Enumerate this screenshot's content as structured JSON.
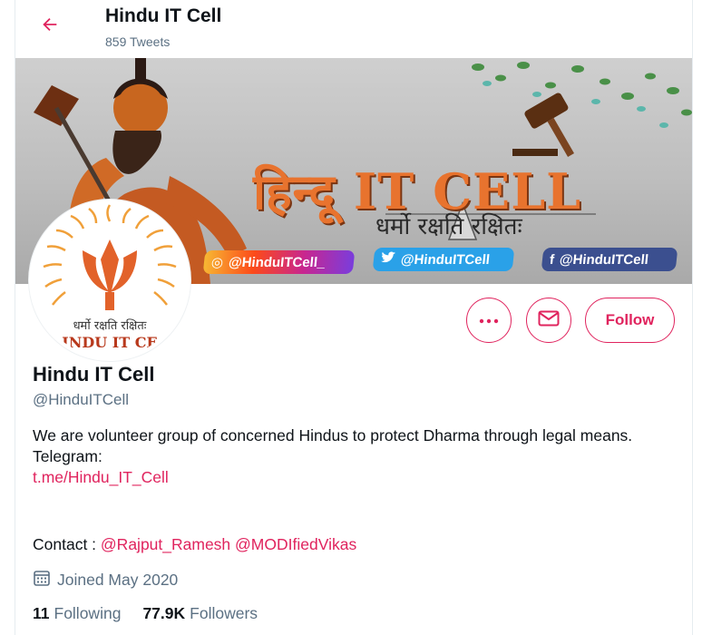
{
  "header": {
    "title": "Hindu IT Cell",
    "tweet_count": "859 Tweets"
  },
  "banner": {
    "title": "हिन्दू IT CELL",
    "motto": "धर्मो रक्षति रक्षितः",
    "instagram": "@HinduITCell_",
    "twitter": "@HinduITCell",
    "facebook": "@HinduITCell"
  },
  "avatar": {
    "motto": "धर्मो रक्षति रक्षितः",
    "name": "INDU IT CE"
  },
  "profile": {
    "name": "Hindu IT Cell",
    "handle": "@HinduITCell",
    "bio_line": "We are volunteer group of concerned Hindus to protect Dharma through legal means.",
    "telegram_label": "Telegram:",
    "telegram_link": "t.me/Hindu_IT_Cell",
    "contact_label": "Contact :",
    "contact_1": "@Rajput_Ramesh",
    "contact_2": "@MODIfiedVikas",
    "joined": "Joined May 2020",
    "following_count": "11",
    "following_label": "Following",
    "followers_count": "77.9K",
    "followers_label": "Followers"
  },
  "actions": {
    "more_icon": "more-horizontal-icon",
    "mail_icon": "envelope-icon",
    "follow_label": "Follow"
  },
  "colors": {
    "accent": "#e0245e",
    "secondary_text": "#5b7083"
  }
}
